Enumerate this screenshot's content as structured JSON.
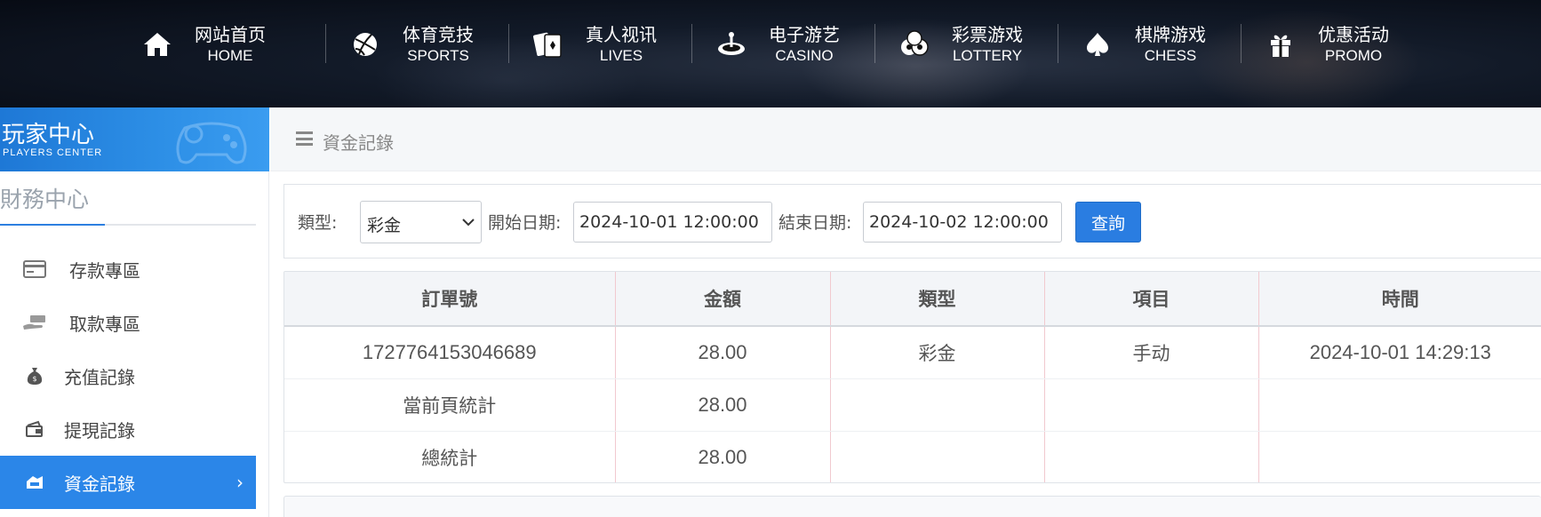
{
  "nav": [
    {
      "cn": "网站首页",
      "en": "HOME",
      "icon": "home-icon"
    },
    {
      "cn": "体育竞技",
      "en": "SPORTS",
      "icon": "ball-icon"
    },
    {
      "cn": "真人视讯",
      "en": "LIVES",
      "icon": "cards-icon"
    },
    {
      "cn": "电子游艺",
      "en": "CASINO",
      "icon": "roulette-icon"
    },
    {
      "cn": "彩票游戏",
      "en": "LOTTERY",
      "icon": "lottery-balls-icon"
    },
    {
      "cn": "棋牌游戏",
      "en": "CHESS",
      "icon": "spade-icon"
    },
    {
      "cn": "优惠活动",
      "en": "PROMO",
      "icon": "gift-icon"
    }
  ],
  "sidebar": {
    "banner_cn": "玩家中心",
    "banner_en": "PLAYERS CENTER",
    "section_title": "財務中心",
    "items": [
      {
        "label": "存款專區",
        "icon": "card-icon"
      },
      {
        "label": "取款專區",
        "icon": "cash-hand-icon"
      },
      {
        "label": "充值記錄",
        "icon": "money-bag-icon"
      },
      {
        "label": "提現記錄",
        "icon": "withdraw-icon"
      },
      {
        "label": "資金記錄",
        "icon": "funds-icon",
        "active": true
      }
    ]
  },
  "breadcrumb": {
    "text": "資金記錄"
  },
  "filter": {
    "type_label": "類型:",
    "type_value": "彩金",
    "start_label": "開始日期:",
    "start_value": "2024-10-01 12:00:00",
    "end_label": "結束日期:",
    "end_value": "2024-10-02 12:00:00",
    "query_label": "查詢"
  },
  "table": {
    "headers": [
      "訂單號",
      "金額",
      "類型",
      "項目",
      "時間"
    ],
    "rows": [
      [
        "1727764153046689",
        "28.00",
        "彩金",
        "手动",
        "2024-10-01 14:29:13"
      ],
      [
        "當前頁統計",
        "28.00",
        "",
        "",
        ""
      ],
      [
        "總統計",
        "28.00",
        "",
        "",
        ""
      ]
    ]
  },
  "colors": {
    "accent": "#2b86e8",
    "nav_bg": "#0b111c",
    "table_divider": "#f1c9cf"
  }
}
